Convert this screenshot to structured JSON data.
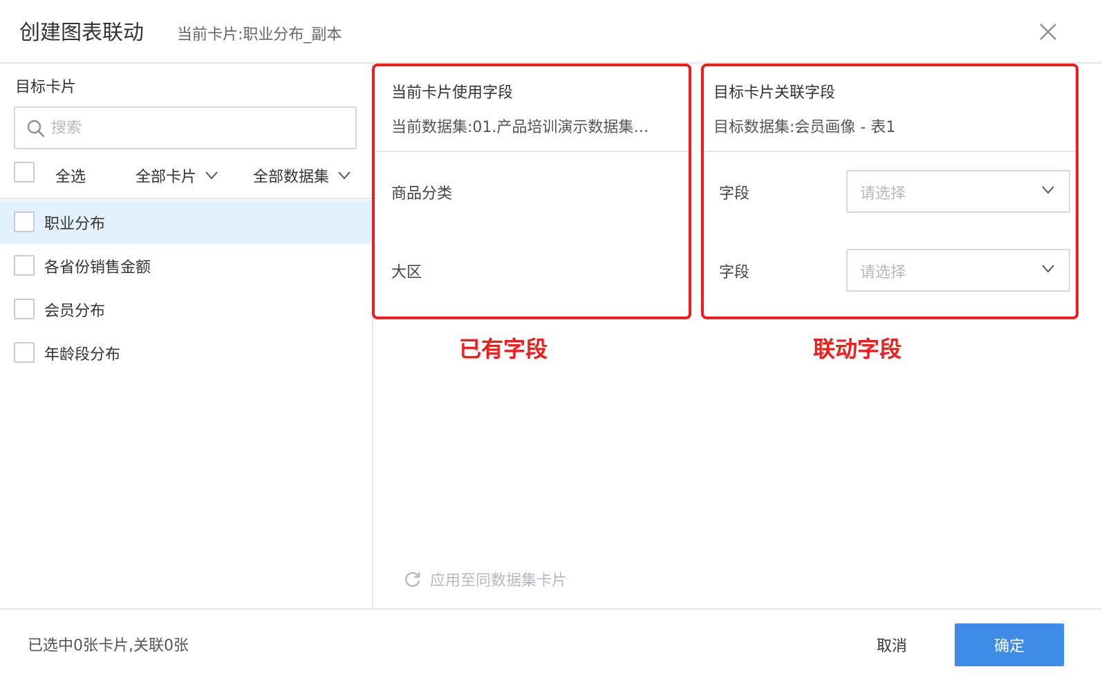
{
  "dialog": {
    "title": "创建图表联动",
    "subtitle": "当前卡片:职业分布_副本"
  },
  "left": {
    "section_label": "目标卡片",
    "search_placeholder": "搜索",
    "select_all": "全选",
    "filter_cards": "全部卡片",
    "filter_datasets": "全部数据集",
    "cards": [
      {
        "label": "职业分布",
        "selected": true
      },
      {
        "label": "各省份销售金额",
        "selected": false
      },
      {
        "label": "会员分布",
        "selected": false
      },
      {
        "label": "年龄段分布",
        "selected": false
      }
    ]
  },
  "current_fields": {
    "title": "当前卡片使用字段",
    "dataset": "当前数据集:01.产品培训演示数据集…",
    "fields": [
      "商品分类",
      "大区"
    ]
  },
  "target_fields": {
    "title": "目标卡片关联字段",
    "dataset": "目标数据集:会员画像 - 表1",
    "rows": [
      {
        "label": "字段",
        "placeholder": "请选择"
      },
      {
        "label": "字段",
        "placeholder": "请选择"
      }
    ]
  },
  "annotations": {
    "existing": "已有字段",
    "linked": "联动字段",
    "color": "#f21c1c"
  },
  "apply_same_dataset": "应用至同数据集卡片",
  "footer": {
    "status": "已选中0张卡片,关联0张",
    "cancel": "取消",
    "confirm": "确定"
  },
  "colors": {
    "accent": "#3f8ce8",
    "selected_row_bg": "#e3f1fd",
    "annotation_red": "#f21c1c"
  },
  "icons": [
    "close-icon",
    "search-icon",
    "chevron-down-icon",
    "refresh-icon"
  ]
}
